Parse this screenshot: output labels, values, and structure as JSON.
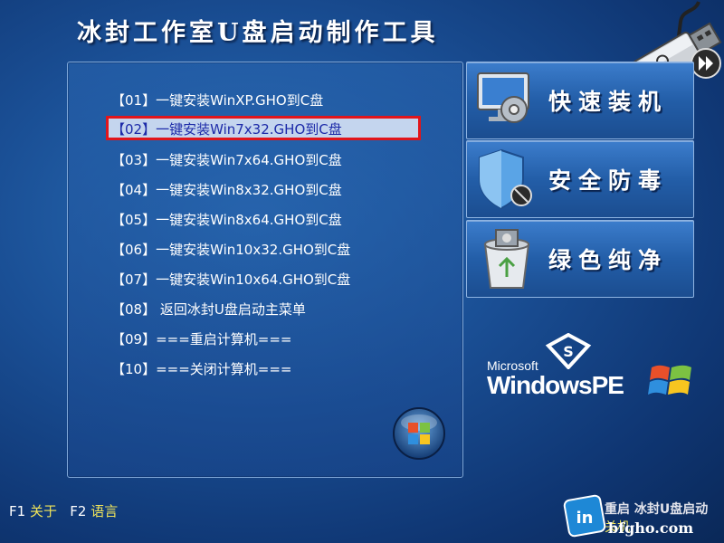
{
  "app": {
    "title": "冰封工作室U盘启动制作工具"
  },
  "menu": {
    "items": [
      {
        "label": "【01】一键安装WinXP.GHO到C盘"
      },
      {
        "label": "【02】一键安装Win7x32.GHO到C盘"
      },
      {
        "label": "【03】一键安装Win7x64.GHO到C盘"
      },
      {
        "label": "【04】一键安装Win8x32.GHO到C盘"
      },
      {
        "label": "【05】一键安装Win8x64.GHO到C盘"
      },
      {
        "label": "【06】一键安装Win10x32.GHO到C盘"
      },
      {
        "label": "【07】一键安装Win10x64.GHO到C盘"
      },
      {
        "label": "【08】 返回冰封U盘启动主菜单"
      },
      {
        "label": "【09】===重启计算机==="
      },
      {
        "label": "【10】===关闭计算机==="
      }
    ],
    "selected_index": 1
  },
  "features": {
    "quick_install": "快速装机",
    "antivirus": "安全防毒",
    "clean": "绿色纯净"
  },
  "branding": {
    "microsoft": "Microsoft",
    "windowspe": "WindowsPE"
  },
  "footer": {
    "f1_key": "F1",
    "f1_label": "关于",
    "f2_key": "F2",
    "f2_label": "语言",
    "restart_label": "重启",
    "shutdown_label": "关机"
  },
  "watermark": {
    "brand": "冰封U盘启动",
    "site": "bfgho.com"
  },
  "colors": {
    "selection_border": "#e1151b",
    "selection_bg": "#c4d5ee",
    "selection_text": "#1c2aa8",
    "hotkey_label": "#f1e55a"
  }
}
